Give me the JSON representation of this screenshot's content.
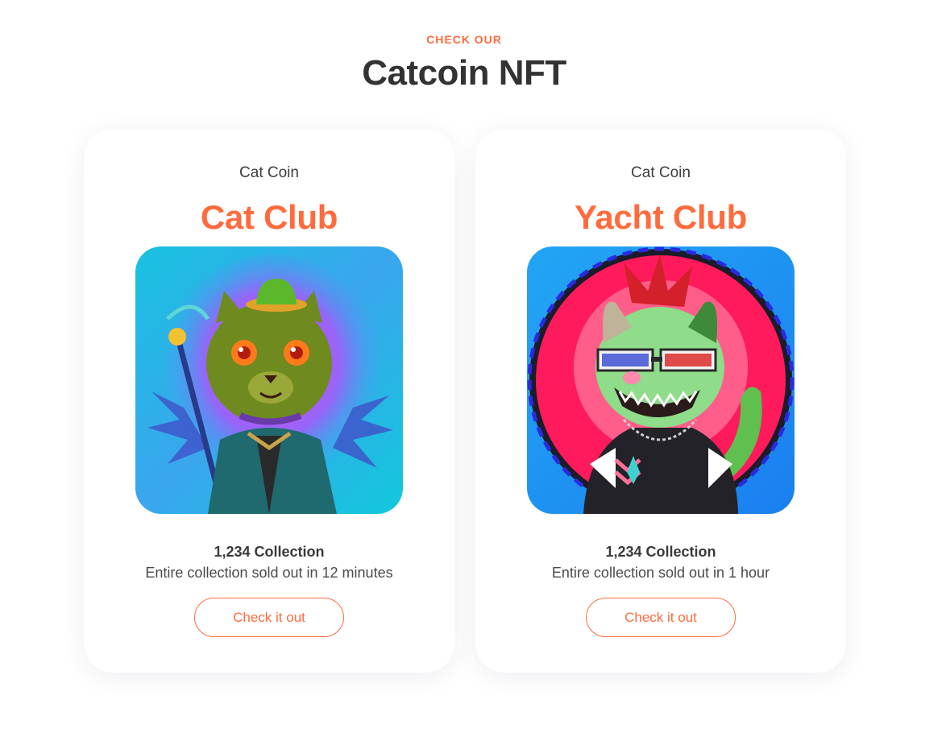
{
  "section": {
    "eyebrow": "CHECK OUR",
    "title": "Catcoin NFT"
  },
  "cards": [
    {
      "brand": "Cat Coin",
      "name": "Cat Club",
      "image_icon": "green-cat-with-staff-image",
      "collection": "1,234 Collection",
      "description": "Entire collection sold out in 12 minutes",
      "button_label": "Check it out"
    },
    {
      "brand": "Cat Coin",
      "name": "Yacht Club",
      "image_icon": "punk-cat-with-3d-glasses-image",
      "collection": "1,234 Collection",
      "description": "Entire collection sold out in 1 hour",
      "button_label": "Check it out"
    }
  ],
  "colors": {
    "accent": "#ff6b3d",
    "heading": "#333333",
    "text": "#3a3a3a"
  }
}
